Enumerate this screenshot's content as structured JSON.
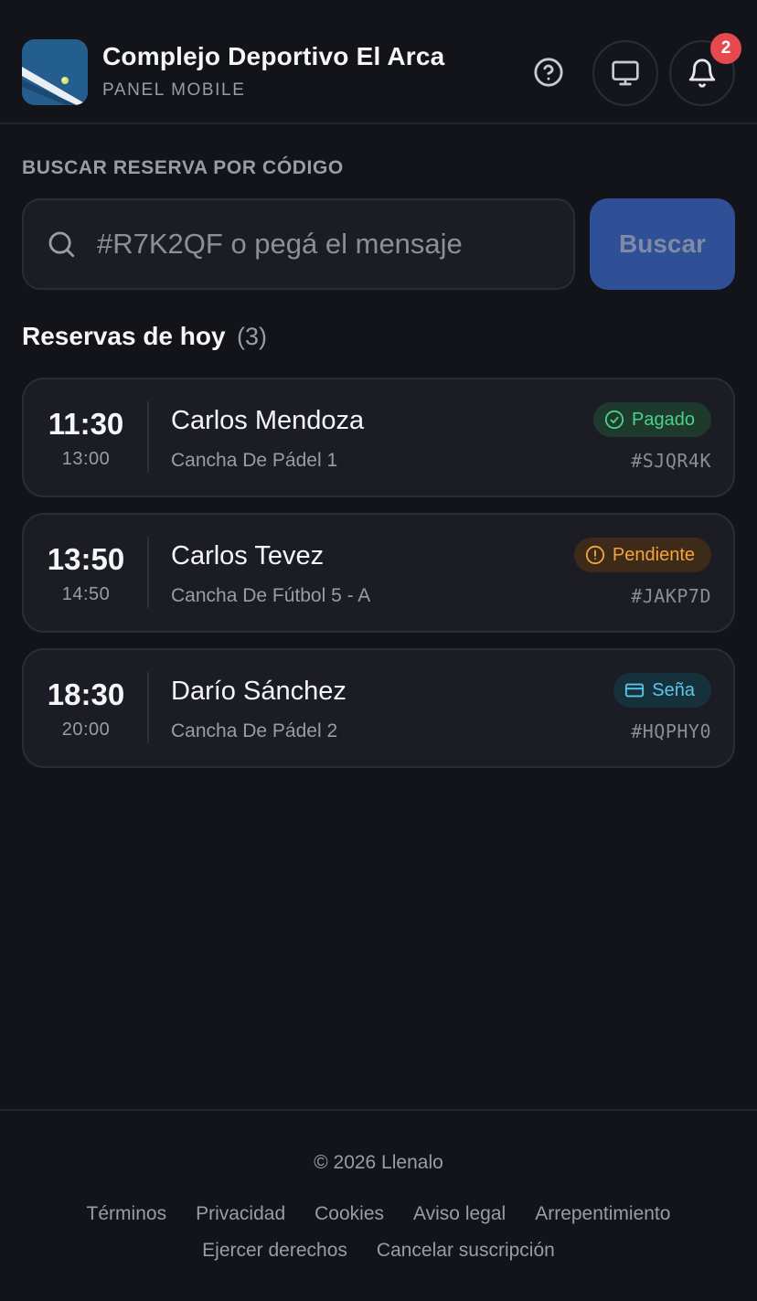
{
  "header": {
    "title": "Complejo Deportivo El Arca",
    "subtitle": "PANEL MOBILE",
    "logo_icon": "padel-court-image",
    "help_icon": "help-circle-icon",
    "desktop_icon": "monitor-icon",
    "bell_icon": "bell-icon",
    "notification_count": "2"
  },
  "search": {
    "label": "BUSCAR RESERVA POR CÓDIGO",
    "placeholder": "#R7K2QF o pegá el mensaje",
    "value": "",
    "button_label": "Buscar"
  },
  "reservations": {
    "title": "Reservas de hoy",
    "count": "(3)",
    "items": [
      {
        "start": "11:30",
        "end": "13:00",
        "name": "Carlos Mendoza",
        "court": "Cancha De Pádel 1",
        "status": "Pagado",
        "status_icon": "check-circle-icon",
        "code": "#SJQR4K"
      },
      {
        "start": "13:50",
        "end": "14:50",
        "name": "Carlos Tevez",
        "court": "Cancha De Fútbol 5 - A",
        "status": "Pendiente",
        "status_icon": "alert-circle-icon",
        "code": "#JAKP7D"
      },
      {
        "start": "18:30",
        "end": "20:00",
        "name": "Darío Sánchez",
        "court": "Cancha De Pádel 2",
        "status": "Seña",
        "status_icon": "credit-card-icon",
        "code": "#HQPHY0"
      }
    ]
  },
  "footer": {
    "copyright": "© 2026 Llenalo",
    "links": [
      "Términos",
      "Privacidad",
      "Cookies",
      "Aviso legal",
      "Arrepentimiento",
      "Ejercer derechos",
      "Cancelar suscripción"
    ]
  },
  "colors": {
    "background": "#13131a",
    "card": "#1b1c24",
    "accent_button": "#2f4f96",
    "badge": "#e5484d",
    "status_paid": "#4ad28a",
    "status_pending": "#f5a43a",
    "status_deposit": "#5cc6e8"
  }
}
